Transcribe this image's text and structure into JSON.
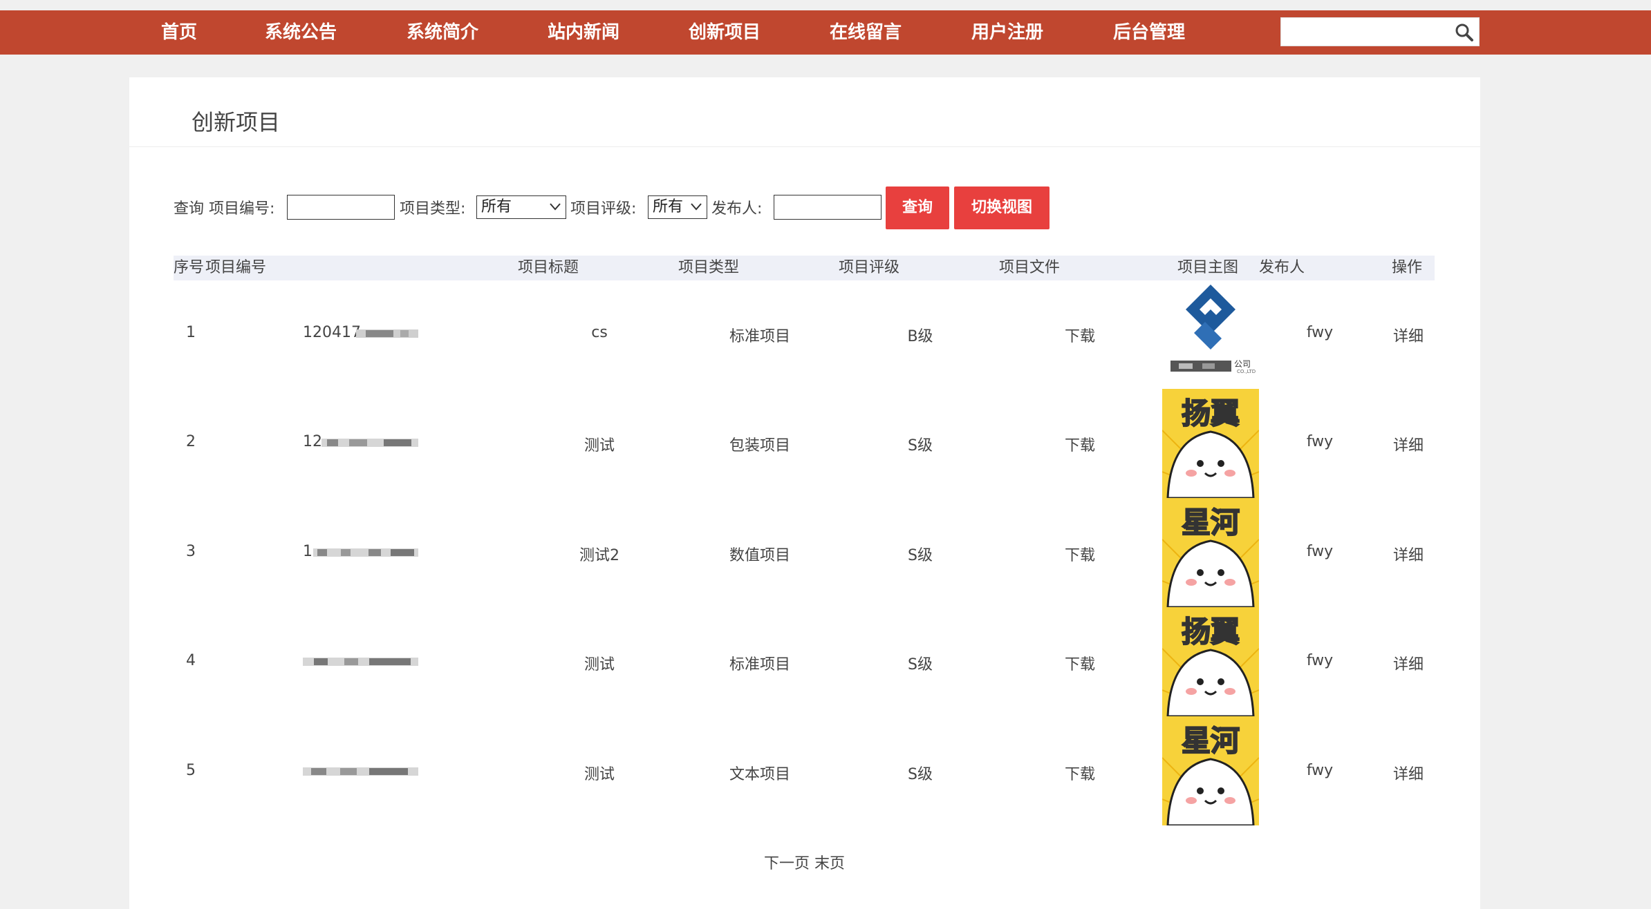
{
  "nav": {
    "items": [
      "首页",
      "系统公告",
      "系统简介",
      "站内新闻",
      "创新项目",
      "在线留言",
      "用户注册",
      "后台管理"
    ],
    "search_placeholder": "",
    "brand_color": "#c0472f"
  },
  "panel": {
    "title": "创新项目"
  },
  "query": {
    "prefix": "查询 项目编号:",
    "type_label": "项目类型:",
    "type_value": "所有",
    "grade_label": "项目评级:",
    "grade_value": "所有",
    "publisher_label": "发布人:",
    "search_btn": "查询",
    "switch_btn": "切换视图"
  },
  "table": {
    "headers": [
      "序号",
      "项目编号",
      "项目标题",
      "项目类型",
      "项目评级",
      "项目文件",
      "项目主图",
      "发布人",
      "操作"
    ],
    "rows": [
      {
        "index": "1",
        "code": "120417",
        "title": "cs",
        "type": "标准项目",
        "grade": "B级",
        "file": "下载",
        "image": "company-logo",
        "publisher": "fwy",
        "action": "详细"
      },
      {
        "index": "2",
        "code": "12",
        "title": "测试",
        "type": "包装项目",
        "grade": "S级",
        "file": "下载",
        "image": "扬翼",
        "publisher": "fwy",
        "action": "详细"
      },
      {
        "index": "3",
        "code": "1",
        "title": "测试2",
        "type": "数值项目",
        "grade": "S级",
        "file": "下载",
        "image": "星河",
        "publisher": "fwy",
        "action": "详细"
      },
      {
        "index": "4",
        "code": "",
        "title": "测试",
        "type": "标准项目",
        "grade": "S级",
        "file": "下载",
        "image": "扬翼",
        "publisher": "fwy",
        "action": "详细"
      },
      {
        "index": "5",
        "code": "",
        "title": "测试",
        "type": "文本项目",
        "grade": "S级",
        "file": "下载",
        "image": "星河",
        "publisher": "fwy",
        "action": "详细"
      }
    ],
    "logo_text": "公司",
    "logo_subtext": "CO.,LTD"
  },
  "pager": {
    "next": "下一页",
    "last": "末页"
  },
  "colors": {
    "button_red": "#e8403e",
    "header_bg": "#eef0f7",
    "thumb_yellow": "#f7d23a",
    "logo_blue": "#1e5a9c"
  }
}
